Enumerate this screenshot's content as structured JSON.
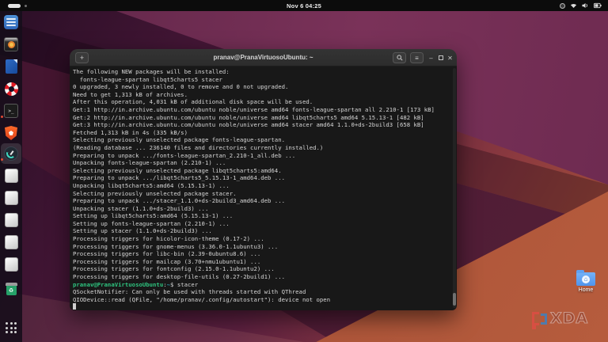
{
  "top_bar": {
    "clock": "Nov 6 04:25",
    "status_icons": [
      "screencast-icon",
      "wifi-icon",
      "volume-icon",
      "battery-icon"
    ]
  },
  "dock": {
    "items": [
      {
        "name": "files"
      },
      {
        "name": "music-player"
      },
      {
        "name": "libreoffice-writer"
      },
      {
        "name": "help"
      },
      {
        "name": "terminal",
        "running": true
      },
      {
        "name": "brave-browser"
      },
      {
        "name": "stacer",
        "running": true,
        "focused": true
      },
      {
        "name": "app-placeholder-1"
      },
      {
        "name": "app-placeholder-2"
      },
      {
        "name": "app-placeholder-3"
      },
      {
        "name": "app-placeholder-4"
      },
      {
        "name": "app-placeholder-5"
      },
      {
        "name": "trash"
      },
      {
        "name": "show-applications"
      }
    ]
  },
  "terminal": {
    "title": "pranav@PranaVirtuosoUbuntu: ~",
    "controls": {
      "new_tab": "+",
      "menu": "≡",
      "minimize": "–",
      "close": "✕"
    },
    "colors": {
      "background": "#181818",
      "foreground": "#d6d6d6",
      "prompt_user": "#2ec27e",
      "prompt_path": "#2aa1b3"
    },
    "lines": [
      {
        "t": "The following NEW packages will be installed:"
      },
      {
        "t": "  fonts-league-spartan libqt5charts5 stacer"
      },
      {
        "t": "0 upgraded, 3 newly installed, 0 to remove and 0 not upgraded."
      },
      {
        "t": "Need to get 1,313 kB of archives."
      },
      {
        "t": "After this operation, 4,031 kB of additional disk space will be used."
      },
      {
        "t": "Get:1 http://in.archive.ubuntu.com/ubuntu noble/universe amd64 fonts-league-spartan all 2.210-1 [173 kB]"
      },
      {
        "t": "Get:2 http://in.archive.ubuntu.com/ubuntu noble/universe amd64 libqt5charts5 amd64 5.15.13-1 [482 kB]"
      },
      {
        "t": "Get:3 http://in.archive.ubuntu.com/ubuntu noble/universe amd64 stacer amd64 1.1.0+ds-2build3 [658 kB]"
      },
      {
        "t": "Fetched 1,313 kB in 4s (335 kB/s)"
      },
      {
        "t": "Selecting previously unselected package fonts-league-spartan."
      },
      {
        "t": "(Reading database ... 236140 files and directories currently installed.)"
      },
      {
        "t": "Preparing to unpack .../fonts-league-spartan_2.210-1_all.deb ..."
      },
      {
        "t": "Unpacking fonts-league-spartan (2.210-1) ..."
      },
      {
        "t": "Selecting previously unselected package libqt5charts5:amd64."
      },
      {
        "t": "Preparing to unpack .../libqt5charts5_5.15.13-1_amd64.deb ..."
      },
      {
        "t": "Unpacking libqt5charts5:amd64 (5.15.13-1) ..."
      },
      {
        "t": "Selecting previously unselected package stacer."
      },
      {
        "t": "Preparing to unpack .../stacer_1.1.0+ds-2build3_amd64.deb ..."
      },
      {
        "t": "Unpacking stacer (1.1.0+ds-2build3) ..."
      },
      {
        "t": "Setting up libqt5charts5:amd64 (5.15.13-1) ..."
      },
      {
        "t": "Setting up fonts-league-spartan (2.210-1) ..."
      },
      {
        "t": "Setting up stacer (1.1.0+ds-2build3) ..."
      },
      {
        "t": "Processing triggers for hicolor-icon-theme (0.17-2) ..."
      },
      {
        "t": "Processing triggers for gnome-menus (3.36.0-1.1ubuntu3) ..."
      },
      {
        "t": "Processing triggers for libc-bin (2.39-0ubuntu8.6) ..."
      },
      {
        "t": "Processing triggers for mailcap (3.70+nmu1ubuntu1) ..."
      },
      {
        "t": "Processing triggers for fontconfig (2.15.0-1.1ubuntu2) ..."
      },
      {
        "t": "Processing triggers for desktop-file-utils (0.27-2build1) ..."
      },
      {
        "prompt": true,
        "user": "pranav@PranaVirtuosoUbuntu",
        "sep": ":",
        "path": "~",
        "dollar": "$",
        "cmd": "stacer"
      },
      {
        "t": "QSocketNotifier: Can only be used with threads started with QThread"
      },
      {
        "t": "QIODevice::read (QFile, \"/home/pranav/.config/autostart\"): device not open"
      },
      {
        "cursor": true
      }
    ]
  },
  "desktop": {
    "home_label": "Home",
    "watermark_text": "XDA"
  }
}
